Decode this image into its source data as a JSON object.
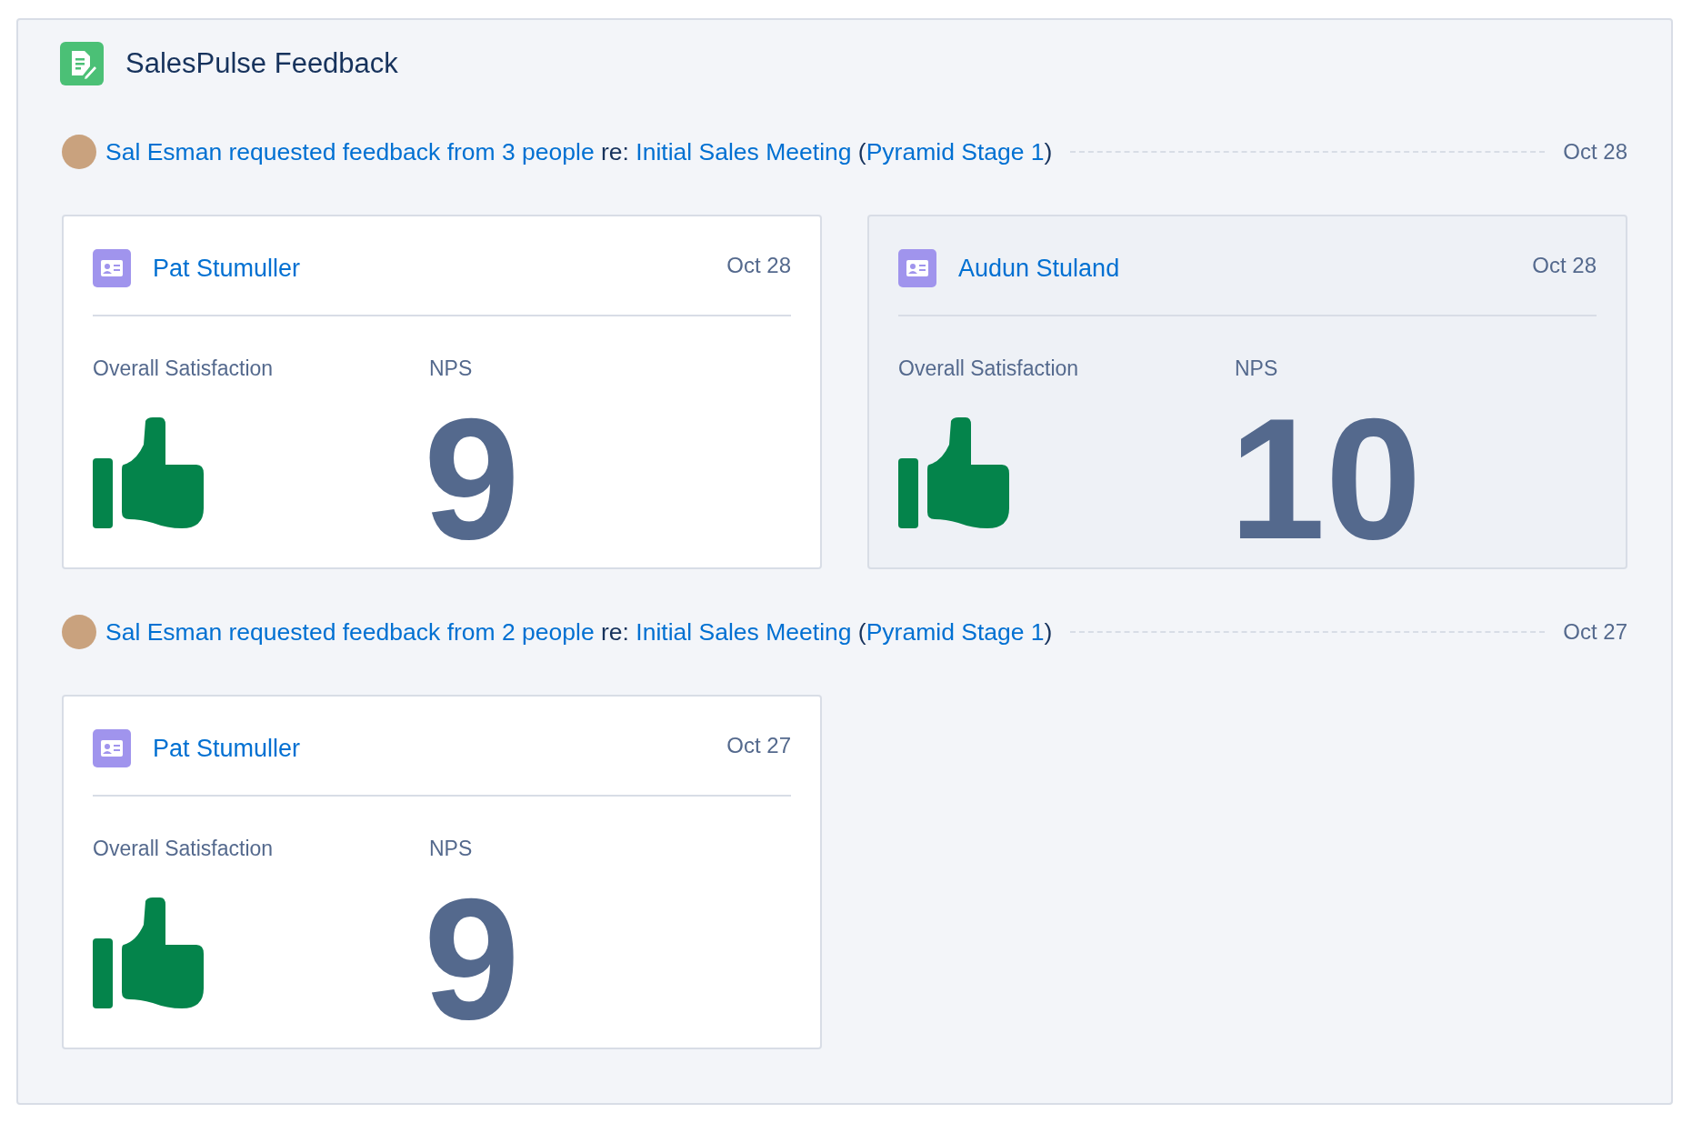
{
  "header": {
    "title": "SalesPulse Feedback"
  },
  "requests": [
    {
      "parts": [
        {
          "text": "Sal Esman requested feedback from 3 people",
          "link": true
        },
        {
          "text": " re: ",
          "link": false
        },
        {
          "text": "Initial Sales Meeting",
          "link": true
        },
        {
          "text": " (",
          "link": false
        },
        {
          "text": "Pyramid Stage 1",
          "link": true
        },
        {
          "text": ")",
          "link": false
        }
      ],
      "date": "Oct 28",
      "responses": [
        {
          "name": "Pat Stumuller",
          "date": "Oct 28",
          "highlighted": false,
          "satisfaction_label": "Overall Satisfaction",
          "satisfaction": {
            "kind": "thumbs_up"
          },
          "nps_label": "NPS",
          "nps": "9"
        },
        {
          "name": "Audun Stuland",
          "date": "Oct 28",
          "highlighted": true,
          "satisfaction_label": "Overall Satisfaction",
          "satisfaction": {
            "kind": "thumbs_up"
          },
          "nps_label": "NPS",
          "nps": "10"
        }
      ]
    },
    {
      "parts": [
        {
          "text": "Sal Esman requested feedback from 2 people",
          "link": true
        },
        {
          "text": " re: ",
          "link": false
        },
        {
          "text": "Initial Sales Meeting",
          "link": true
        },
        {
          "text": " (",
          "link": false
        },
        {
          "text": "Pyramid Stage 1",
          "link": true
        },
        {
          "text": ")",
          "link": false
        }
      ],
      "date": "Oct 27",
      "responses": [
        {
          "name": "Pat Stumuller",
          "date": "Oct 27",
          "highlighted": false,
          "satisfaction_label": "Overall Satisfaction",
          "satisfaction": {
            "kind": "thumbs_up"
          },
          "nps_label": "NPS",
          "nps": "9"
        }
      ]
    }
  ]
}
